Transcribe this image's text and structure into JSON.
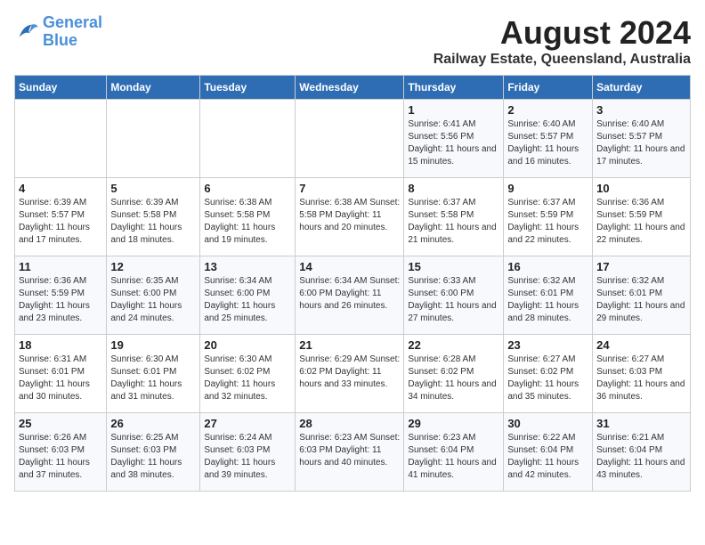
{
  "logo": {
    "line1": "General",
    "line2": "Blue"
  },
  "title": "August 2024",
  "subtitle": "Railway Estate, Queensland, Australia",
  "days_of_week": [
    "Sunday",
    "Monday",
    "Tuesday",
    "Wednesday",
    "Thursday",
    "Friday",
    "Saturday"
  ],
  "weeks": [
    [
      {
        "day": "",
        "info": ""
      },
      {
        "day": "",
        "info": ""
      },
      {
        "day": "",
        "info": ""
      },
      {
        "day": "",
        "info": ""
      },
      {
        "day": "1",
        "info": "Sunrise: 6:41 AM\nSunset: 5:56 PM\nDaylight: 11 hours\nand 15 minutes."
      },
      {
        "day": "2",
        "info": "Sunrise: 6:40 AM\nSunset: 5:57 PM\nDaylight: 11 hours\nand 16 minutes."
      },
      {
        "day": "3",
        "info": "Sunrise: 6:40 AM\nSunset: 5:57 PM\nDaylight: 11 hours\nand 17 minutes."
      }
    ],
    [
      {
        "day": "4",
        "info": "Sunrise: 6:39 AM\nSunset: 5:57 PM\nDaylight: 11 hours\nand 17 minutes."
      },
      {
        "day": "5",
        "info": "Sunrise: 6:39 AM\nSunset: 5:58 PM\nDaylight: 11 hours\nand 18 minutes."
      },
      {
        "day": "6",
        "info": "Sunrise: 6:38 AM\nSunset: 5:58 PM\nDaylight: 11 hours\nand 19 minutes."
      },
      {
        "day": "7",
        "info": "Sunrise: 6:38 AM\nSunset: 5:58 PM\nDaylight: 11 hours\nand 20 minutes."
      },
      {
        "day": "8",
        "info": "Sunrise: 6:37 AM\nSunset: 5:58 PM\nDaylight: 11 hours\nand 21 minutes."
      },
      {
        "day": "9",
        "info": "Sunrise: 6:37 AM\nSunset: 5:59 PM\nDaylight: 11 hours\nand 22 minutes."
      },
      {
        "day": "10",
        "info": "Sunrise: 6:36 AM\nSunset: 5:59 PM\nDaylight: 11 hours\nand 22 minutes."
      }
    ],
    [
      {
        "day": "11",
        "info": "Sunrise: 6:36 AM\nSunset: 5:59 PM\nDaylight: 11 hours\nand 23 minutes."
      },
      {
        "day": "12",
        "info": "Sunrise: 6:35 AM\nSunset: 6:00 PM\nDaylight: 11 hours\nand 24 minutes."
      },
      {
        "day": "13",
        "info": "Sunrise: 6:34 AM\nSunset: 6:00 PM\nDaylight: 11 hours\nand 25 minutes."
      },
      {
        "day": "14",
        "info": "Sunrise: 6:34 AM\nSunset: 6:00 PM\nDaylight: 11 hours\nand 26 minutes."
      },
      {
        "day": "15",
        "info": "Sunrise: 6:33 AM\nSunset: 6:00 PM\nDaylight: 11 hours\nand 27 minutes."
      },
      {
        "day": "16",
        "info": "Sunrise: 6:32 AM\nSunset: 6:01 PM\nDaylight: 11 hours\nand 28 minutes."
      },
      {
        "day": "17",
        "info": "Sunrise: 6:32 AM\nSunset: 6:01 PM\nDaylight: 11 hours\nand 29 minutes."
      }
    ],
    [
      {
        "day": "18",
        "info": "Sunrise: 6:31 AM\nSunset: 6:01 PM\nDaylight: 11 hours\nand 30 minutes."
      },
      {
        "day": "19",
        "info": "Sunrise: 6:30 AM\nSunset: 6:01 PM\nDaylight: 11 hours\nand 31 minutes."
      },
      {
        "day": "20",
        "info": "Sunrise: 6:30 AM\nSunset: 6:02 PM\nDaylight: 11 hours\nand 32 minutes."
      },
      {
        "day": "21",
        "info": "Sunrise: 6:29 AM\nSunset: 6:02 PM\nDaylight: 11 hours\nand 33 minutes."
      },
      {
        "day": "22",
        "info": "Sunrise: 6:28 AM\nSunset: 6:02 PM\nDaylight: 11 hours\nand 34 minutes."
      },
      {
        "day": "23",
        "info": "Sunrise: 6:27 AM\nSunset: 6:02 PM\nDaylight: 11 hours\nand 35 minutes."
      },
      {
        "day": "24",
        "info": "Sunrise: 6:27 AM\nSunset: 6:03 PM\nDaylight: 11 hours\nand 36 minutes."
      }
    ],
    [
      {
        "day": "25",
        "info": "Sunrise: 6:26 AM\nSunset: 6:03 PM\nDaylight: 11 hours\nand 37 minutes."
      },
      {
        "day": "26",
        "info": "Sunrise: 6:25 AM\nSunset: 6:03 PM\nDaylight: 11 hours\nand 38 minutes."
      },
      {
        "day": "27",
        "info": "Sunrise: 6:24 AM\nSunset: 6:03 PM\nDaylight: 11 hours\nand 39 minutes."
      },
      {
        "day": "28",
        "info": "Sunrise: 6:23 AM\nSunset: 6:03 PM\nDaylight: 11 hours\nand 40 minutes."
      },
      {
        "day": "29",
        "info": "Sunrise: 6:23 AM\nSunset: 6:04 PM\nDaylight: 11 hours\nand 41 minutes."
      },
      {
        "day": "30",
        "info": "Sunrise: 6:22 AM\nSunset: 6:04 PM\nDaylight: 11 hours\nand 42 minutes."
      },
      {
        "day": "31",
        "info": "Sunrise: 6:21 AM\nSunset: 6:04 PM\nDaylight: 11 hours\nand 43 minutes."
      }
    ]
  ]
}
